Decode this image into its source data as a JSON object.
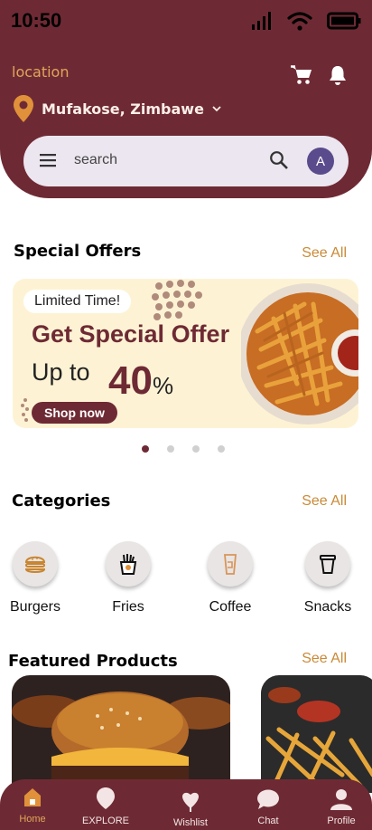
{
  "status": {
    "time": "10:50"
  },
  "header": {
    "location_label": "location",
    "location_name": "Mufakose, Zimbawe"
  },
  "search": {
    "placeholder": "search",
    "avatar_letter": "A"
  },
  "special_offers": {
    "title": "Special Offers",
    "see_all": "See All",
    "banner": {
      "badge": "Limited Time!",
      "headline": "Get Special Offer",
      "up_to": "Up to",
      "percent": "40",
      "percent_sign": "%",
      "button": "Shop now"
    },
    "carousel_pages": 4,
    "active_page": 1
  },
  "categories": {
    "title": "Categories",
    "see_all": "See All",
    "items": [
      {
        "label": "Burgers",
        "icon": "burger-icon"
      },
      {
        "label": "Fries",
        "icon": "fries-icon"
      },
      {
        "label": "Coffee",
        "icon": "coffee-icon"
      },
      {
        "label": "Snacks",
        "icon": "snacks-icon"
      }
    ]
  },
  "featured": {
    "title": "Featured Products",
    "see_all": "See All"
  },
  "bottom_nav": [
    {
      "label": "Home",
      "icon": "home-icon",
      "active": true
    },
    {
      "label": "EXPLORE",
      "icon": "explore-icon"
    },
    {
      "label": "Wishlist",
      "icon": "wishlist-icon"
    },
    {
      "label": "Chat",
      "icon": "chat-icon"
    },
    {
      "label": "Profile",
      "icon": "profile-icon"
    }
  ],
  "colors": {
    "brand": "#6e2a34",
    "accent": "#e0a55b",
    "see_all": "#c98a37",
    "banner_bg": "#fdf3d4"
  }
}
